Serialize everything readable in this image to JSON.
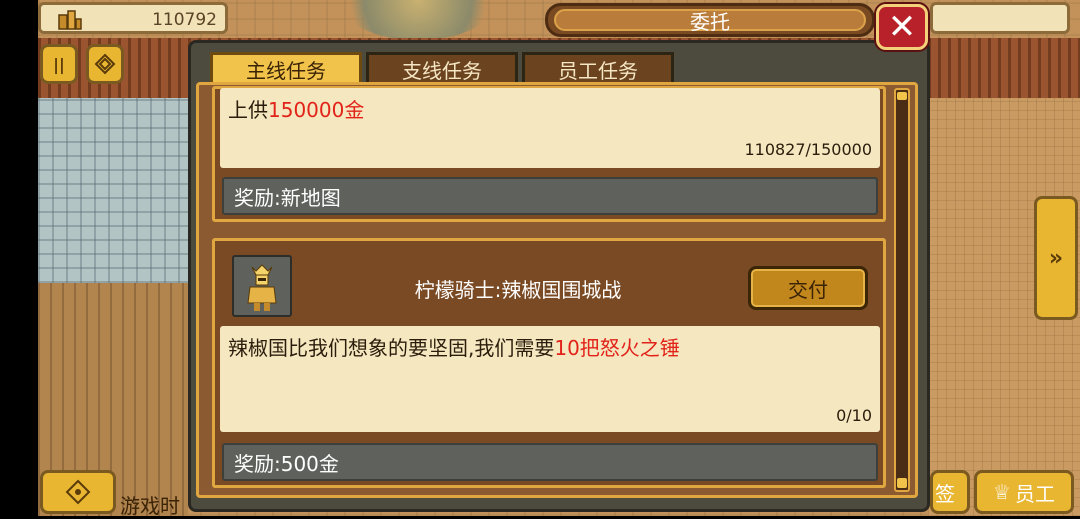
{
  "hud": {
    "money": "110792",
    "bottom_left_label": "游戏时",
    "bottom_right_partial": "签",
    "staff_button": "员工"
  },
  "dialog": {
    "title": "委托",
    "tabs": [
      {
        "label": "主线任务",
        "active": true
      },
      {
        "label": "支线任务",
        "active": false
      },
      {
        "label": "员工任务",
        "active": false
      }
    ]
  },
  "quests": [
    {
      "desc_prefix": "上供",
      "desc_highlight": "150000金",
      "progress": "110827/150000",
      "reward": "奖励:新地图"
    },
    {
      "title": "柠檬骑士:辣椒国围城战",
      "desc_prefix": "辣椒国比我们想象的要坚固,我们需要",
      "desc_highlight": "10把怒火之锤",
      "progress": "0/10",
      "reward": "奖励:500金",
      "action": "交付"
    }
  ],
  "colors": {
    "highlight": "#e2231a",
    "accent": "#e0a740"
  }
}
